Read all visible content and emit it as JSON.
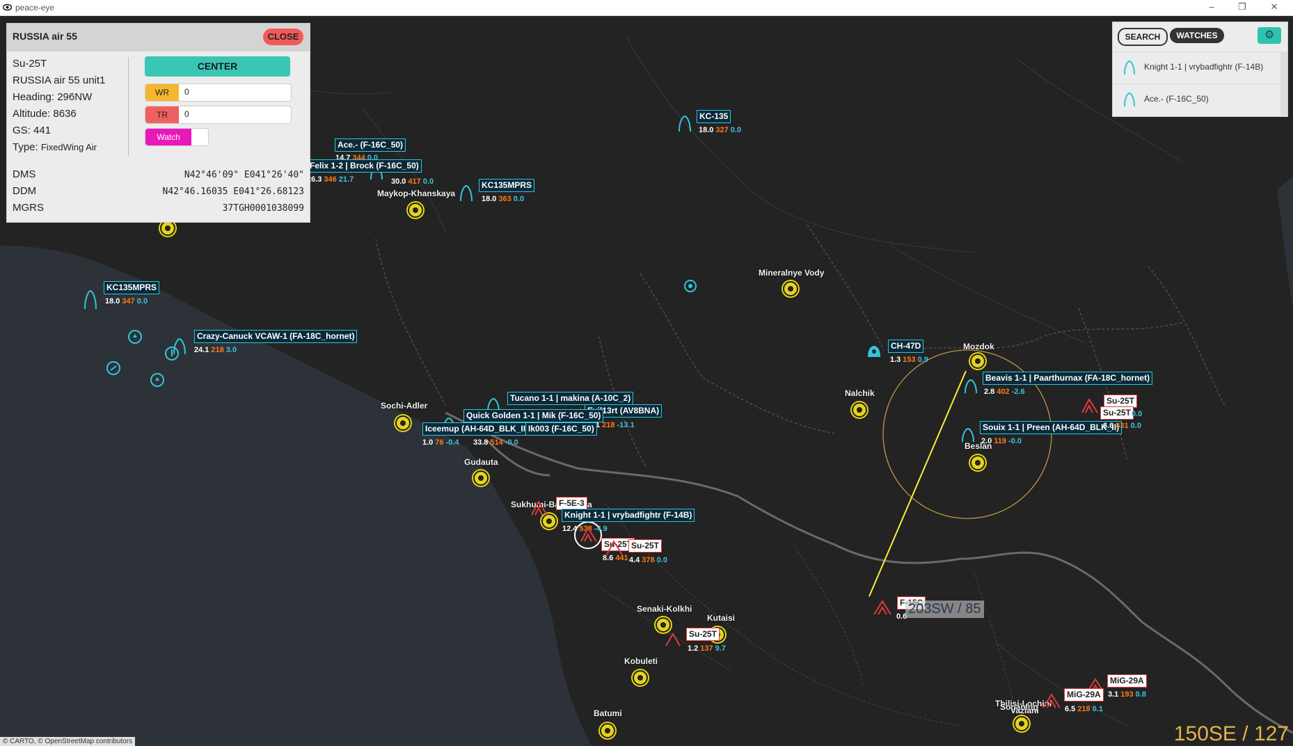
{
  "window": {
    "title": "peace-eye"
  },
  "info": {
    "header": "RUSSIA air 55",
    "close_label": "CLOSE",
    "type": "Su-25T",
    "unit": "RUSSIA air 55 unit1",
    "heading": "Heading: 296NW",
    "altitude": "Altitude: 8636",
    "gs": "GS: 441",
    "type_label": "Type:",
    "type_value": "FixedWing Air",
    "center_label": "CENTER",
    "wr_label": "WR",
    "wr_value": "0",
    "tr_label": "TR",
    "tr_value": "0",
    "watch_label": "Watch",
    "dms_label": "DMS",
    "dms_value": "N42°46'09\" E041°26'40\"",
    "ddm_label": "DDM",
    "ddm_value": "N42°46.16035 E041°26.68123",
    "mgrs_label": "MGRS",
    "mgrs_value": "37TGH0001038099"
  },
  "watches": {
    "search_label": "SEARCH",
    "watches_label": "WATCHES",
    "items": [
      "Knight 1-1 | vrybadfightr (F-14B)",
      "Ace.- (F-16C_50)"
    ]
  },
  "colors": {
    "friendly": "#31c6d9",
    "hostile": "#e03a3a",
    "airport": "#e6d31a",
    "altitude": "#ffffff",
    "speed": "#ff7a1a",
    "vspeed": "#3fc3e0",
    "bullseye": "#e4b44a"
  },
  "cities": [
    {
      "name": "Maykop-Khanskaya"
    },
    {
      "name": "Mineralnye Vody"
    },
    {
      "name": "Mozdok"
    },
    {
      "name": "Nalchik"
    },
    {
      "name": "Beslan"
    },
    {
      "name": "Sochi-Adler"
    },
    {
      "name": "Gudauta"
    },
    {
      "name": "Sukhumi-Babushara"
    },
    {
      "name": "Senaki-Kolkhi"
    },
    {
      "name": "Kobuleti"
    },
    {
      "name": "Batumi"
    },
    {
      "name": "Tbilisi-Lochini"
    },
    {
      "name": "Soganlug"
    },
    {
      "name": "Vaziani"
    },
    {
      "name": "Kutaisi"
    }
  ],
  "units": [
    {
      "label": "KC-135",
      "alt": "18.0",
      "spd": "327",
      "vs": "0.0",
      "side": "blue"
    },
    {
      "label": "KC135MPRS",
      "alt": "18.0",
      "spd": "363",
      "vs": "0.0",
      "side": "blue"
    },
    {
      "label": "KC135MPRS",
      "alt": "18.0",
      "spd": "347",
      "vs": "0.0",
      "side": "blue"
    },
    {
      "label": "Ace.- (F-16C_50)",
      "alt": "14.7",
      "spd": "344",
      "vs": "0.0",
      "side": "blue"
    },
    {
      "label": "Felix 1-2 | Brock (F-16C_50)",
      "alt": "26.3",
      "spd": "346",
      "vs": "21.7",
      "side": "blue"
    },
    {
      "label": "",
      "alt": "30.0",
      "spd": "417",
      "vs": "0.0",
      "side": "blue"
    },
    {
      "label": "Crazy-Canuck VCAW-1 (FA-18C_hornet)",
      "alt": "24.1",
      "spd": "218",
      "vs": "3.0",
      "side": "blue"
    },
    {
      "label": "CH-47D",
      "alt": "1.3",
      "spd": "153",
      "vs": "0.9",
      "side": "blue"
    },
    {
      "label": "Beavis 1-1 | Paarthurnax (FA-18C_hornet)",
      "alt": "2.8",
      "spd": "402",
      "vs": "-2.6",
      "side": "blue"
    },
    {
      "label": "Souix 1-1 | Preen (AH-64D_BLK_II)",
      "alt": "2.0",
      "spd": "119",
      "vs": "-0.0",
      "side": "blue"
    },
    {
      "label": "Tucano 1-1 | makina (A-10C_2)",
      "alt": "",
      "spd": "",
      "vs": "",
      "side": "blue"
    },
    {
      "label": "Evil13rt (AV8BNA)",
      "alt": "1",
      "spd": "218",
      "vs": "-13.1",
      "side": "blue"
    },
    {
      "label": "Quick Golden 1-1 | Mik (F-16C_50)",
      "alt": "",
      "spd": "",
      "vs": "",
      "side": "blue"
    },
    {
      "label": "Iceemup (AH-64D_BLK_II)",
      "alt": "1.0",
      "spd": "76",
      "vs": "-0.4",
      "side": "blue"
    },
    {
      "label": "Ik003 (F-16C_50)",
      "alt": "33.8",
      "spd": "514",
      "vs": "-0.0",
      "side": "blue"
    },
    {
      "label": "F-5E-3",
      "alt": "",
      "spd": "",
      "vs": "",
      "side": "red"
    },
    {
      "label": "Knight 1-1 | vrybadfightr (F-14B)",
      "alt": "12.4",
      "spd": "538",
      "vs": "-4.9",
      "side": "blue"
    },
    {
      "label": "Su-25T",
      "alt": "8.6",
      "spd": "441",
      "vs": "",
      "side": "red"
    },
    {
      "label": "Su-25T",
      "alt": "4.4",
      "spd": "378",
      "vs": "0.0",
      "side": "red"
    },
    {
      "label": "Su-25T",
      "alt": "1.2",
      "spd": "137",
      "vs": "9.7",
      "side": "red"
    },
    {
      "label": "Su-25T",
      "alt": "6.6",
      "spd": "331",
      "vs": "0.0",
      "side": "red"
    },
    {
      "label": "Su-25T",
      "alt": "",
      "spd": "",
      "vs": "0.0",
      "side": "red"
    },
    {
      "label": "F-15C",
      "alt": "0.6",
      "spd": "",
      "vs": "",
      "side": "red"
    },
    {
      "label": "MiG-29A",
      "alt": "3.1",
      "spd": "193",
      "vs": "0.8",
      "side": "red"
    },
    {
      "label": "MiG-29A",
      "alt": "6.5",
      "spd": "218",
      "vs": "0.1",
      "side": "red"
    }
  ],
  "bearing_readout": "203SW / 85",
  "bullseye_readout": "150SE / 127",
  "attribution": "© CARTO, © OpenStreetMap contributors"
}
